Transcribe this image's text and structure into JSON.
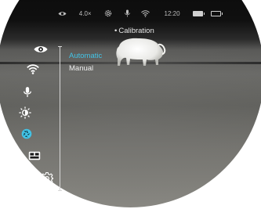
{
  "status_bar": {
    "zoom": "4.0×",
    "time": "12:20",
    "icons": [
      "eye-icon",
      "gear-icon",
      "microphone-icon",
      "wifi-icon",
      "battery-icon",
      "battery-icon"
    ]
  },
  "menu": {
    "title": "Calibration",
    "title_bullet": "•",
    "options": [
      {
        "label": "Automatic",
        "selected": true
      },
      {
        "label": "Manual",
        "selected": false
      }
    ],
    "selected_color": "#42c3e6"
  },
  "sidebar": {
    "icons": [
      "eye-icon",
      "wifi-icon",
      "microphone-icon",
      "brightness-icon",
      "calibration-icon",
      "picture-in-picture-icon",
      "settings-icon"
    ],
    "active_icon": "calibration-icon",
    "active_color": "#42c3e6"
  }
}
